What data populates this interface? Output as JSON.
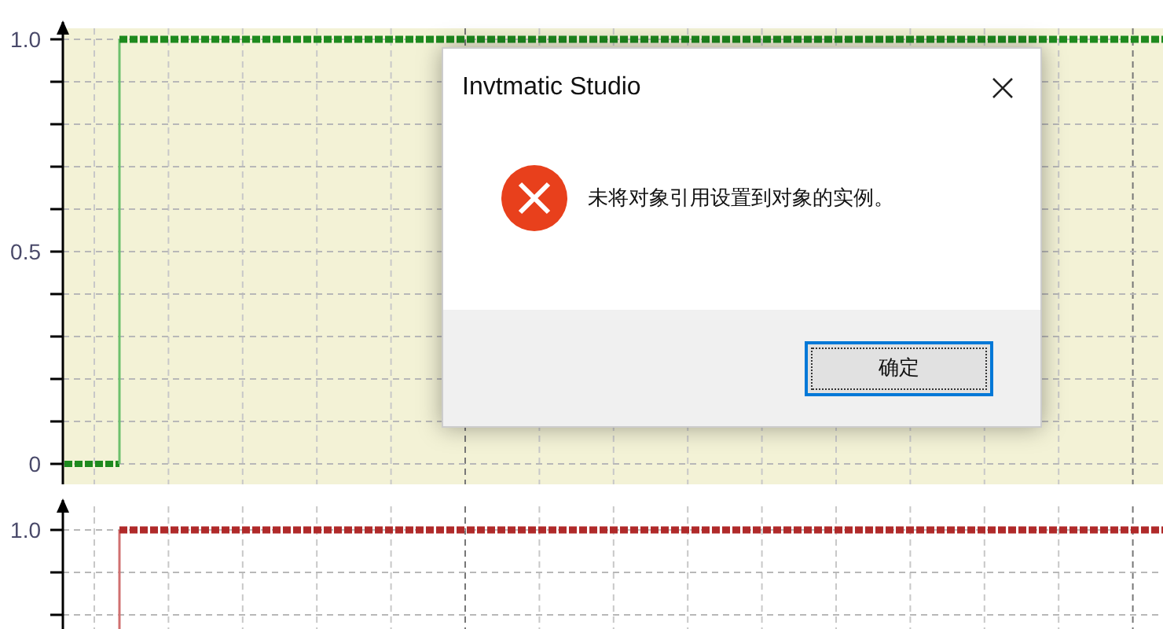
{
  "plots": [
    {
      "kind": "green",
      "y_labels": [
        "1.0",
        "0.5",
        "0"
      ]
    },
    {
      "kind": "red",
      "y_labels": [
        "1.0"
      ]
    }
  ],
  "dialog": {
    "title": "Invtmatic Studio",
    "kind": "error",
    "message": "未将对象引用设置到对象的实例。",
    "buttons": [
      {
        "label": "确定",
        "selected": true
      }
    ]
  }
}
